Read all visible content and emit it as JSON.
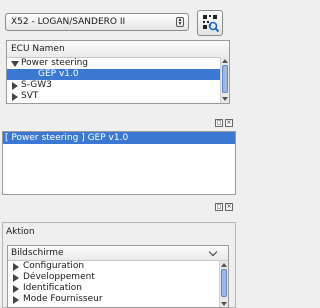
{
  "vehicle": {
    "selected": "X52 - LOGAN/SANDERO II"
  },
  "ecu_tree": {
    "header": "ECU Namen",
    "items": [
      {
        "label": "Power steering",
        "state": "expanded"
      },
      {
        "label": "GEP v1.0",
        "state": "selected"
      },
      {
        "label": "S-GW3",
        "state": "collapsed"
      },
      {
        "label": "SVT",
        "state": "collapsed"
      }
    ]
  },
  "info_panel": {
    "selected_ecu": "[ Power steering ] GEP v1.0"
  },
  "actions": {
    "title": "Aktion",
    "screens_header": "Bildschirme",
    "items": [
      "Configuration",
      "Développement",
      "Identification",
      "Mode Fournisseur"
    ]
  },
  "colors": {
    "selection": "#3b78d4",
    "panel_bg": "#efefef"
  },
  "icons": {
    "scan": "search-qr-icon",
    "float": "float-icon",
    "close": "close-icon",
    "expanded": "triangle-down-icon",
    "collapsed": "triangle-right-icon",
    "dropdown": "chevron-down-icon"
  }
}
